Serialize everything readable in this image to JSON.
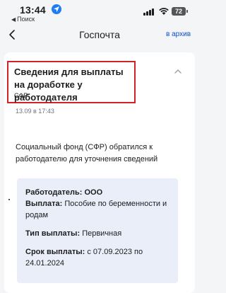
{
  "status_bar": {
    "time": "13:44",
    "back_app": "Поиск",
    "battery": "72"
  },
  "nav": {
    "title": "Госпочта",
    "archive_link": "в архив"
  },
  "message": {
    "title": "Сведения для выплаты на доработке у работодателя",
    "sender": "СФР",
    "date": "13.09 в 17:43",
    "body": "Социальный фонд (СФР) обратился к работодателю для уточнения сведений",
    "details": {
      "employer_label": "Работодатель:",
      "employer_value": "ООО",
      "payment_label": "Выплата:",
      "payment_value": "Пособие по беременности и родам",
      "type_label": "Тип выплаты:",
      "type_value": "Первичная",
      "term_label": "Срок выплаты:",
      "term_value": "с 07.09.2023 по 24.01.2024"
    }
  },
  "colors": {
    "accent": "#0d4cd3",
    "highlight": "#d2232a",
    "info_bg": "#e9eef8"
  }
}
